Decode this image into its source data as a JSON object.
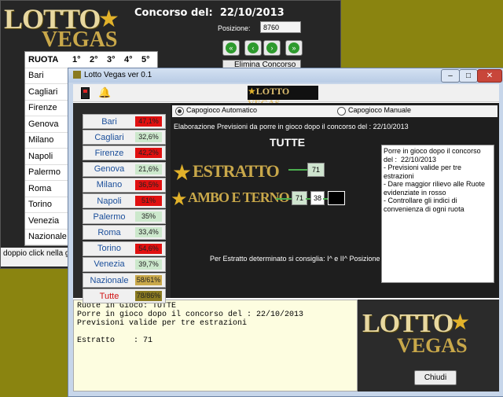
{
  "back_window": {
    "logo": {
      "top": "LOTTO",
      "bottom": "VEGAS"
    },
    "concorso_label": "Concorso del:",
    "concorso_date": "22/10/2013",
    "posizione_label": "Posizione:",
    "posizione_value": "8760",
    "table_headers": [
      "RUOTA",
      "1°",
      "2°",
      "3°",
      "4°",
      "5°"
    ],
    "wheels": [
      "Bari",
      "Cagliari",
      "Firenze",
      "Genova",
      "Milano",
      "Napoli",
      "Palermo",
      "Roma",
      "Torino",
      "Venezia",
      "Nazionale"
    ],
    "elimina_label": "Elimina Concorso",
    "status_text": "doppio click nella gri"
  },
  "front_window": {
    "title": "Lotto Vegas ver 0.1",
    "banner": "LOTTO VEGAS",
    "radio_auto": "Capogioco Automatico",
    "radio_manual": "Capogioco Manuale",
    "elaborazione": "Elaborazione Previsioni da porre in gioco dopo il concorso del :  22/10/2013",
    "tutte": "TUTTE",
    "estratto_label": "ESTRATTO",
    "estratto_value": "71",
    "ambo_label": "AMBO E TERNO",
    "ambo_value1": "71",
    "ambo_value2": "38",
    "consiglio": "Per Estratto determinato si consiglia:  I^ e II^ Posizione",
    "notes": "Porre in gioco dopo il concorso del :  22/10/2013\n- Previsioni valide per tre estrazioni\n- Dare maggior rilievo alle Ruote evidenziate in rosso\n- Controllare gli indici di convenienza di ogni ruota",
    "output_text": "Ruote in Gioco: TUTTE\nPorre in gioco dopo il concorso del : 22/10/2013\nPrevisioni valide per tre estrazioni\n\nEstratto    : 71",
    "chiudi_label": "Chiudi",
    "logo": {
      "top": "LOTTO",
      "bottom": "VEGAS"
    },
    "wheels": [
      {
        "name": "Bari",
        "pct": "47,1%",
        "color": "#e01010"
      },
      {
        "name": "Cagliari",
        "pct": "32,6%",
        "color": "#cce8cc"
      },
      {
        "name": "Firenze",
        "pct": "42,2%",
        "color": "#e01010"
      },
      {
        "name": "Genova",
        "pct": "21,6%",
        "color": "#cce8cc"
      },
      {
        "name": "Milano",
        "pct": "36,5%",
        "color": "#e01010"
      },
      {
        "name": "Napoli",
        "pct": "51%",
        "color": "#e01010"
      },
      {
        "name": "Palermo",
        "pct": "35%",
        "color": "#cce8cc"
      },
      {
        "name": "Roma",
        "pct": "33,4%",
        "color": "#cce8cc"
      },
      {
        "name": "Torino",
        "pct": "54,6%",
        "color": "#e01010"
      },
      {
        "name": "Venezia",
        "pct": "39,7%",
        "color": "#cce8cc"
      },
      {
        "name": "Nazionale",
        "pct": "58/61%",
        "color": "#c9a84a"
      },
      {
        "name": "Tutte",
        "pct": "78/86%",
        "color": "#8a7a20"
      }
    ]
  }
}
